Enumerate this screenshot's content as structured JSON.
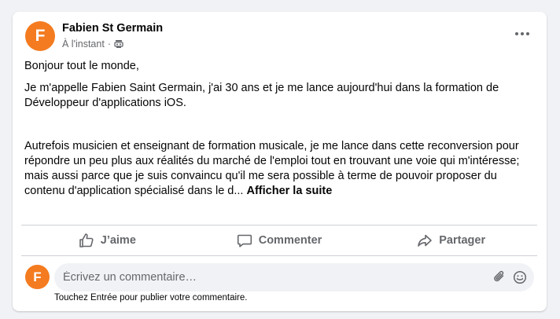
{
  "post": {
    "author_initial": "F",
    "author_name": "Fabien St Germain",
    "timestamp": "À l'instant",
    "separator": "·",
    "audience_icon": "group-icon",
    "more_icon": "more-dots-icon",
    "paragraph_1": "Bonjour tout le monde,",
    "paragraph_2": "Je m'appelle Fabien Saint Germain, j'ai 30 ans et je me lance aujourd'hui dans la formation de Développeur d'applications iOS.",
    "paragraph_3": "Autrefois musicien et enseignant de formation musicale, je me lance dans cette reconversion pour répondre un peu plus aux réalités du marché de l'emploi tout en trouvant une voie qui m'intéresse; mais aussi parce que je suis convaincu qu'il me sera possible à terme de pouvoir proposer du contenu d'application spécialisé dans le d...",
    "see_more": "Afficher la suite"
  },
  "actions": {
    "like": {
      "label": "J’aime",
      "icon": "thumbs-up-icon"
    },
    "comment": {
      "label": "Commenter",
      "icon": "comment-icon"
    },
    "share": {
      "label": "Partager",
      "icon": "share-icon"
    }
  },
  "composer": {
    "avatar_initial": "F",
    "placeholder": "Écrivez un commentaire…",
    "attach_icon": "paperclip-icon",
    "emoji_icon": "smiley-icon",
    "hint": "Touchez Entrée pour publier votre commentaire."
  },
  "colors": {
    "avatar": "#f47b20",
    "secondary_text": "#65676b",
    "input_background": "#f0f2f5"
  }
}
